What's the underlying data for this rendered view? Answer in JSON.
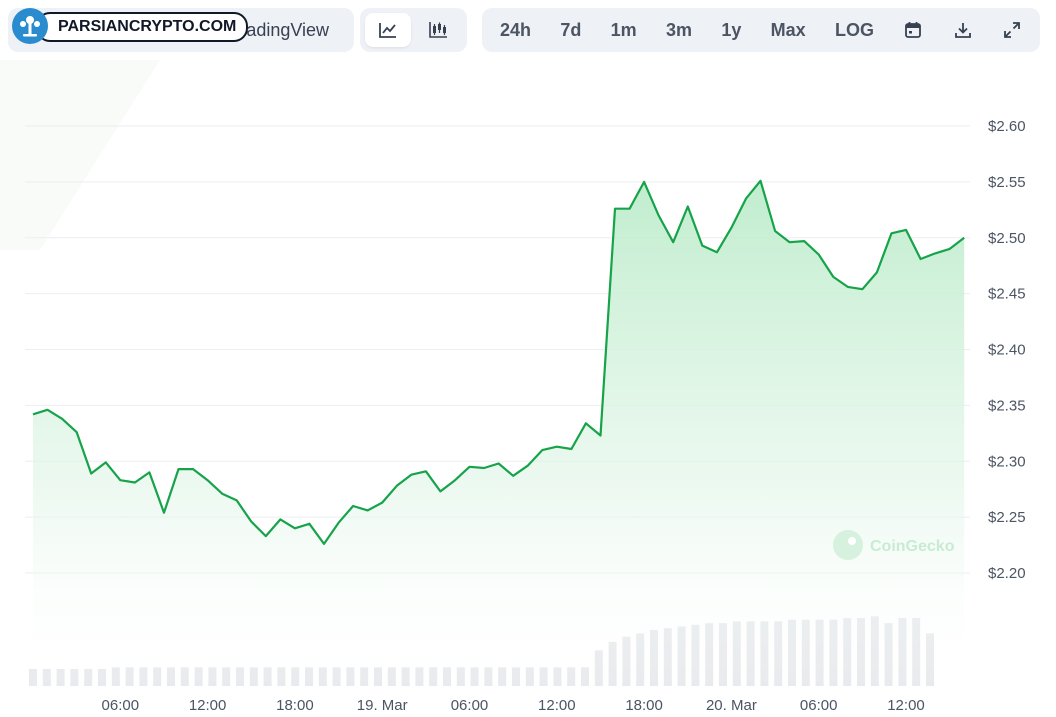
{
  "branding": {
    "logo_text": "PARSIANCRYPTO.COM",
    "watermark": "CoinGecko"
  },
  "toolbar": {
    "tradingview_label": "TradingView",
    "chart_types": [
      {
        "icon": "line-chart-icon",
        "active": true
      },
      {
        "icon": "candlestick-chart-icon",
        "active": false
      }
    ],
    "ranges": [
      "24h",
      "7d",
      "1m",
      "3m",
      "1y",
      "Max",
      "LOG"
    ],
    "actions": [
      "calendar-icon",
      "download-icon",
      "expand-icon"
    ]
  },
  "colors": {
    "line": "#16a34a",
    "fill_top": "#bbf0c8",
    "volume": "#e8eaed",
    "grid": "#eceef1"
  },
  "chart_data": {
    "type": "area",
    "title": "",
    "xlabel": "",
    "ylabel": "",
    "ylim": [
      2.2,
      2.6
    ],
    "yticks": [
      2.2,
      2.25,
      2.3,
      2.35,
      2.4,
      2.45,
      2.5,
      2.55,
      2.6
    ],
    "ytick_labels": [
      "$2.20",
      "$2.25",
      "$2.30",
      "$2.35",
      "$2.40",
      "$2.45",
      "$2.50",
      "$2.55",
      "$2.60"
    ],
    "xtick_labels": [
      {
        "label": "06:00",
        "hour": 6
      },
      {
        "label": "12:00",
        "hour": 12
      },
      {
        "label": "18:00",
        "hour": 18
      },
      {
        "label": "19. Mar",
        "hour": 24
      },
      {
        "label": "06:00",
        "hour": 30
      },
      {
        "label": "12:00",
        "hour": 36
      },
      {
        "label": "18:00",
        "hour": 42
      },
      {
        "label": "20. Mar",
        "hour": 48
      },
      {
        "label": "06:00",
        "hour": 54
      },
      {
        "label": "12:00",
        "hour": 60
      }
    ],
    "x_hours": [
      0,
      1,
      2,
      3,
      4,
      5,
      6,
      7,
      8,
      9,
      10,
      11,
      12,
      13,
      14,
      15,
      16,
      17,
      18,
      19,
      20,
      21,
      22,
      23,
      24,
      25,
      26,
      27,
      28,
      29,
      30,
      31,
      32,
      33,
      34,
      35,
      36,
      37,
      38,
      39,
      40,
      41,
      42,
      43,
      44,
      45,
      46,
      47,
      48,
      49,
      50,
      51,
      52,
      53,
      54,
      55,
      56,
      57,
      58,
      59,
      60,
      61,
      62,
      63,
      64
    ],
    "series": [
      {
        "values": [
          2.342,
          2.346,
          2.338,
          2.326,
          2.289,
          2.299,
          2.283,
          2.281,
          2.29,
          2.254,
          2.293,
          2.293,
          2.283,
          2.271,
          2.265,
          2.246,
          2.233,
          2.248,
          2.24,
          2.244,
          2.226,
          2.245,
          2.26,
          2.256,
          2.263,
          2.278,
          2.288,
          2.291,
          2.273,
          2.283,
          2.295,
          2.294,
          2.298,
          2.287,
          2.296,
          2.31,
          2.313,
          2.311,
          2.334,
          2.323,
          2.526,
          2.526,
          2.55,
          2.52,
          2.496,
          2.528,
          2.493,
          2.487,
          2.509,
          2.535,
          2.551,
          2.506,
          2.496,
          2.497,
          2.485,
          2.465,
          2.456,
          2.454,
          2.469,
          2.504,
          2.507,
          2.481,
          2.486,
          2.49,
          2.5
        ]
      }
    ],
    "volume": [
      0.1,
      0.1,
      0.1,
      0.1,
      0.1,
      0.1,
      0.11,
      0.11,
      0.11,
      0.11,
      0.11,
      0.11,
      0.11,
      0.11,
      0.11,
      0.11,
      0.11,
      0.11,
      0.11,
      0.11,
      0.11,
      0.11,
      0.11,
      0.11,
      0.11,
      0.11,
      0.11,
      0.11,
      0.11,
      0.11,
      0.11,
      0.11,
      0.11,
      0.11,
      0.11,
      0.11,
      0.11,
      0.11,
      0.11,
      0.11,
      0.11,
      0.21,
      0.26,
      0.29,
      0.31,
      0.33,
      0.34,
      0.35,
      0.36,
      0.37,
      0.37,
      0.38,
      0.38,
      0.38,
      0.38,
      0.39,
      0.39,
      0.39,
      0.39,
      0.4,
      0.4,
      0.41,
      0.37,
      0.4,
      0.4,
      0.31
    ]
  }
}
